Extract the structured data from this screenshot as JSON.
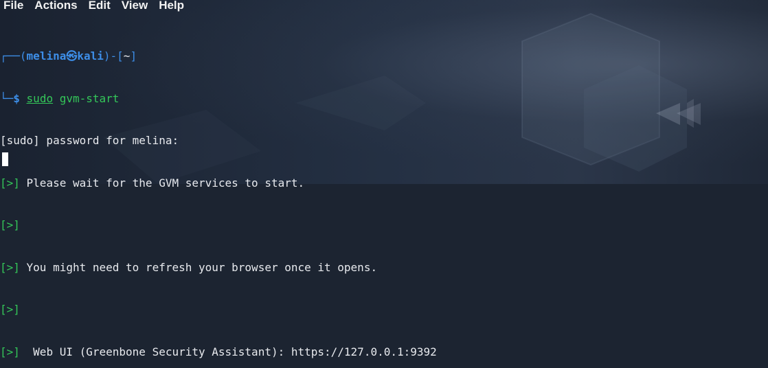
{
  "menu": {
    "file": "File",
    "actions": "Actions",
    "edit": "Edit",
    "view": "View",
    "help": "Help"
  },
  "prompt": {
    "corner_top": "┌──",
    "open": "(",
    "user": "melina",
    "at_icon": "㉿",
    "host": "kali",
    "close_dir_open": ")-[",
    "dir": "~",
    "dir_close": "]",
    "corner_bottom": "└─",
    "dollar": "$",
    "command_sudo": "sudo",
    "command_rest": " gvm-start"
  },
  "output": [
    {
      "marker": "",
      "text": "[sudo] password for melina:"
    },
    {
      "marker": "[>]",
      "text": " Please wait for the GVM services to start."
    },
    {
      "marker": "[>]",
      "text": ""
    },
    {
      "marker": "[>]",
      "text": " You might need to refresh your browser once it opens."
    },
    {
      "marker": "[>]",
      "text": ""
    },
    {
      "marker": "[>]",
      "text": "  Web UI (Greenbone Security Assistant): https://127.0.0.1:9392"
    }
  ],
  "colors": {
    "prompt_blue": "#3d8ee8",
    "marker_green": "#34c759",
    "background": "#1c2431"
  }
}
